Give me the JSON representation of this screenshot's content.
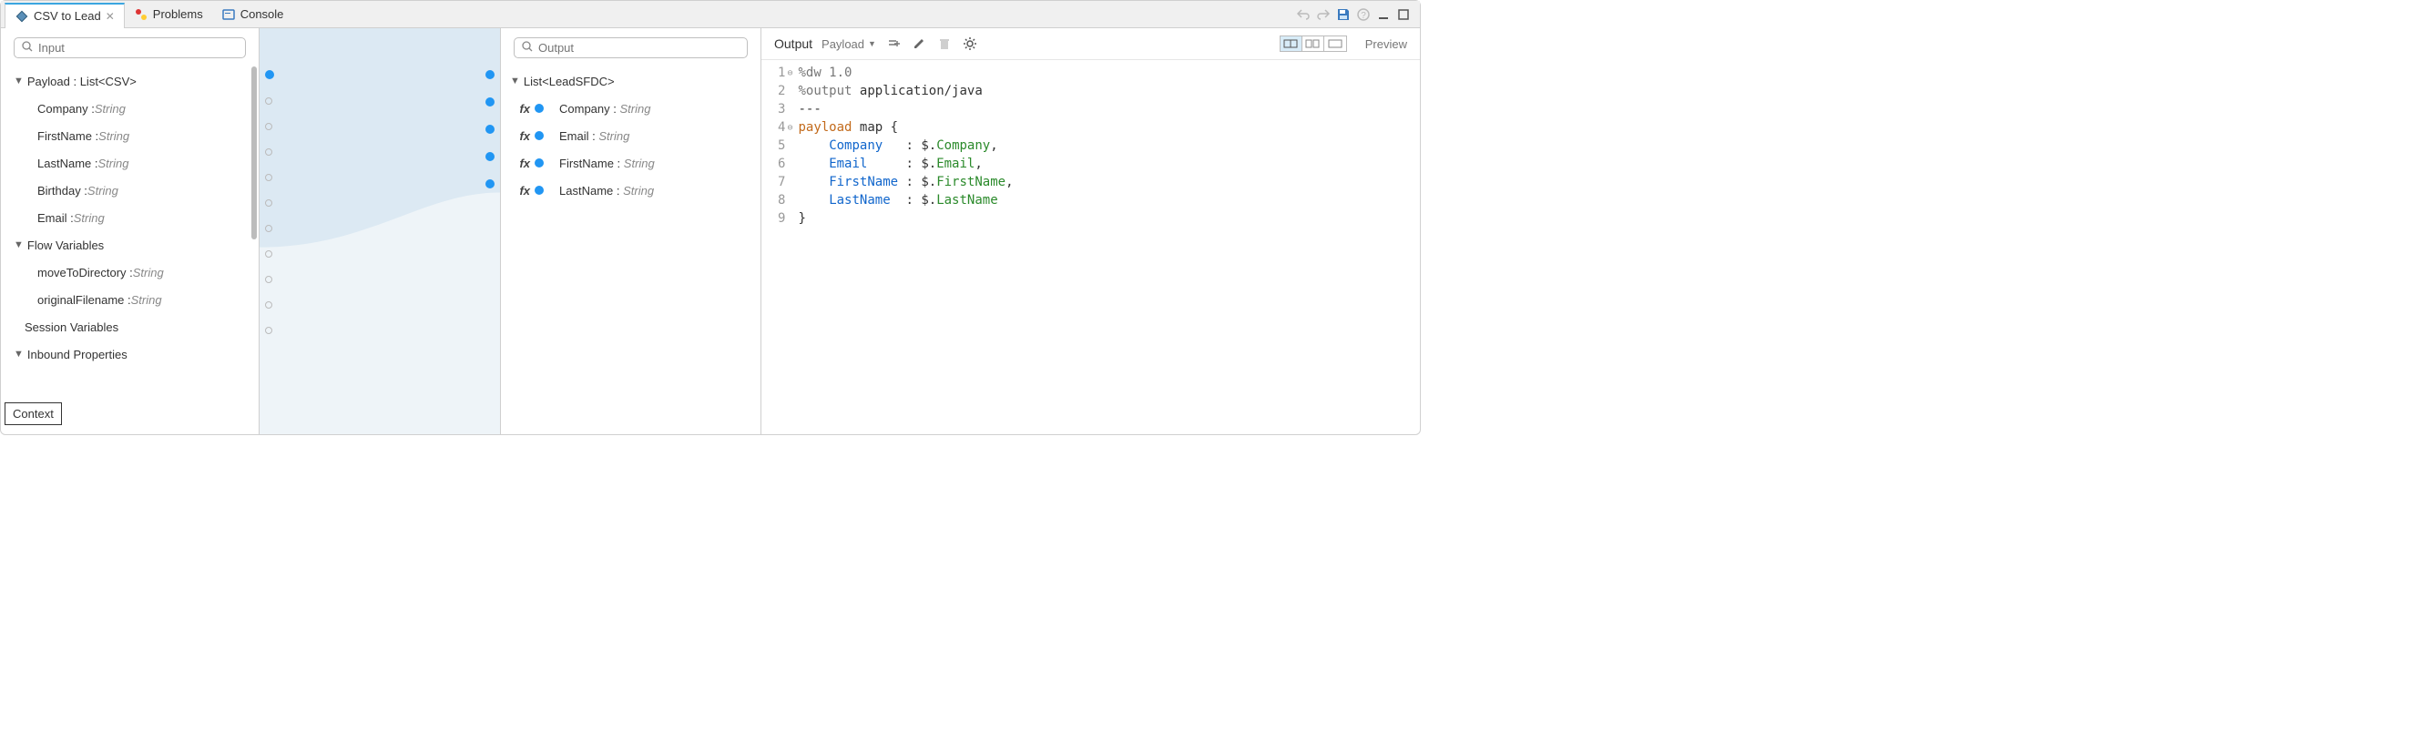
{
  "tabs": [
    {
      "label": "CSV to Lead",
      "icon": "diamond"
    },
    {
      "label": "Problems",
      "icon": "problems"
    },
    {
      "label": "Console",
      "icon": "console"
    }
  ],
  "left": {
    "search_placeholder": "Input",
    "payload_header": "Payload : List<CSV>",
    "payload_fields": [
      {
        "name": "Company",
        "type": "String"
      },
      {
        "name": "FirstName",
        "type": "String"
      },
      {
        "name": "LastName",
        "type": "String"
      },
      {
        "name": "Birthday",
        "type": "String"
      },
      {
        "name": "Email",
        "type": "String"
      }
    ],
    "flow_vars_header": "Flow Variables",
    "flow_vars": [
      {
        "name": "moveToDirectory",
        "type": "String"
      },
      {
        "name": "originalFilename",
        "type": "String"
      }
    ],
    "session_vars_header": "Session Variables",
    "inbound_props_header": "Inbound Properties",
    "context_label": "Context"
  },
  "mid": {
    "search_placeholder": "Output",
    "list_header": "List<LeadSFDC>",
    "fields": [
      {
        "name": "Company",
        "type": "String"
      },
      {
        "name": "Email",
        "type": "String"
      },
      {
        "name": "FirstName",
        "type": "String"
      },
      {
        "name": "LastName",
        "type": "String"
      }
    ]
  },
  "right": {
    "output_label": "Output",
    "dropdown_label": "Payload",
    "preview_label": "Preview",
    "code": {
      "lines": [
        {
          "n": 1,
          "fold": true,
          "segs": [
            {
              "c": "tk-dir",
              "t": "%dw 1.0"
            }
          ]
        },
        {
          "n": 2,
          "segs": [
            {
              "c": "tk-dir",
              "t": "%output "
            },
            {
              "c": "tk-txt",
              "t": "application/java"
            }
          ]
        },
        {
          "n": 3,
          "segs": [
            {
              "c": "tk-txt",
              "t": "---"
            }
          ]
        },
        {
          "n": 4,
          "fold": true,
          "segs": [
            {
              "c": "tk-key",
              "t": "payload"
            },
            {
              "c": "tk-txt",
              "t": " map {"
            }
          ]
        },
        {
          "n": 5,
          "segs": [
            {
              "c": "tk-txt",
              "t": "    "
            },
            {
              "c": "tk-prop",
              "t": "Company"
            },
            {
              "c": "tk-txt",
              "t": "   : $."
            },
            {
              "c": "tk-val",
              "t": "Company"
            },
            {
              "c": "tk-txt",
              "t": ","
            }
          ]
        },
        {
          "n": 6,
          "segs": [
            {
              "c": "tk-txt",
              "t": "    "
            },
            {
              "c": "tk-prop",
              "t": "Email"
            },
            {
              "c": "tk-txt",
              "t": "     : $."
            },
            {
              "c": "tk-val",
              "t": "Email"
            },
            {
              "c": "tk-txt",
              "t": ","
            }
          ]
        },
        {
          "n": 7,
          "segs": [
            {
              "c": "tk-txt",
              "t": "    "
            },
            {
              "c": "tk-prop",
              "t": "FirstName"
            },
            {
              "c": "tk-txt",
              "t": " : $."
            },
            {
              "c": "tk-val",
              "t": "FirstName"
            },
            {
              "c": "tk-txt",
              "t": ","
            }
          ]
        },
        {
          "n": 8,
          "segs": [
            {
              "c": "tk-txt",
              "t": "    "
            },
            {
              "c": "tk-prop",
              "t": "LastName"
            },
            {
              "c": "tk-txt",
              "t": "  : $."
            },
            {
              "c": "tk-val",
              "t": "LastName"
            }
          ]
        },
        {
          "n": 9,
          "segs": [
            {
              "c": "tk-txt",
              "t": "}"
            }
          ]
        }
      ]
    }
  }
}
